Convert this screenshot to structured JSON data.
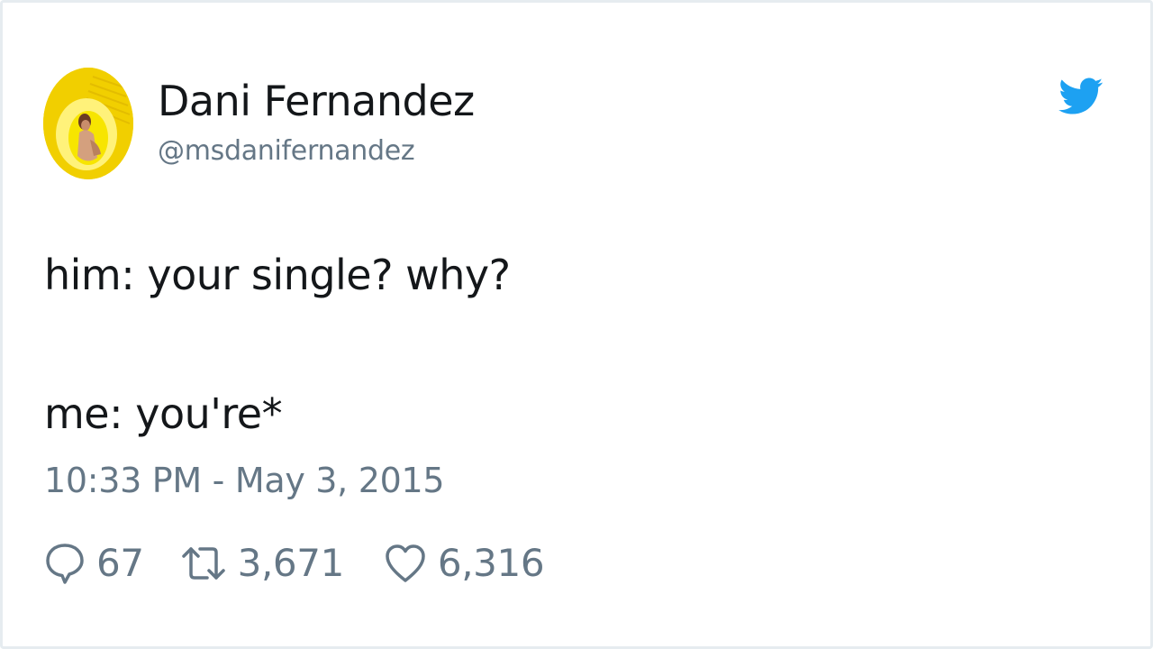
{
  "user": {
    "display_name": "Dani Fernandez",
    "handle": "@msdanifernandez",
    "avatar_icon": "profile-photo"
  },
  "tweet": {
    "lines": [
      "him: your single? why?",
      "me: you're*"
    ],
    "timestamp": "10:33 PM - May 3, 2015"
  },
  "actions": {
    "reply": {
      "icon": "reply-bubble-icon",
      "count": "67"
    },
    "retweet": {
      "icon": "retweet-icon",
      "count": "3,671"
    },
    "like": {
      "icon": "heart-icon",
      "count": "6,316"
    }
  },
  "colors": {
    "text": "#14171a",
    "secondary": "#657786",
    "brand_blue": "#1da1f2",
    "avatar_yellow": "#f2d300"
  }
}
